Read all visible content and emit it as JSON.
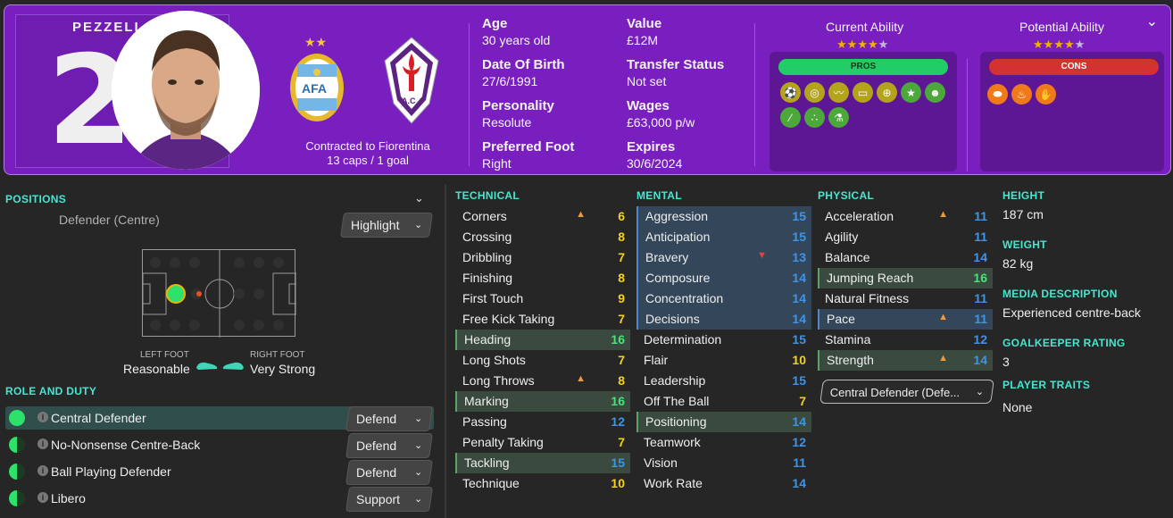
{
  "header": {
    "surname": "PEZZELLA",
    "number": "2",
    "contract": "Contracted to Fiorentina",
    "caps": "13 caps / 1 goal",
    "age": {
      "label": "Age",
      "value": "30 years old"
    },
    "dob": {
      "label": "Date Of Birth",
      "value": "27/6/1991"
    },
    "personality": {
      "label": "Personality",
      "value": "Resolute"
    },
    "foot": {
      "label": "Preferred Foot",
      "value": "Right"
    },
    "value": {
      "label": "Value",
      "value": "£12M"
    },
    "transfer": {
      "label": "Transfer Status",
      "value": "Not set"
    },
    "wages": {
      "label": "Wages",
      "value": "£63,000 p/w"
    },
    "expires": {
      "label": "Expires",
      "value": "30/6/2024"
    },
    "current_ability": {
      "label": "Current Ability",
      "stars": 3.5,
      "max": 5
    },
    "potential_ability": {
      "label": "Potential Ability",
      "stars": 3.5,
      "max": 5
    },
    "pros_label": "PROS",
    "cons_label": "CONS",
    "pros_icons": [
      "aerial-ball-icon",
      "target-icon",
      "trend-icon",
      "pitch-icon",
      "globe-icon",
      "star-icon",
      "head-icon",
      "bandage-icon",
      "cells-icon",
      "flask-icon"
    ],
    "cons_icons": [
      "pills-icon",
      "whistle-icon",
      "hand-icon"
    ],
    "colors": {
      "banner": "#7a1fbf",
      "pros": "#22cc66",
      "cons": "#d43131"
    }
  },
  "positions": {
    "title": "POSITIONS",
    "name": "Defender (Centre)",
    "highlight": "Highlight",
    "left_foot_label": "LEFT FOOT",
    "left_foot": "Reasonable",
    "right_foot_label": "RIGHT FOOT",
    "right_foot": "Very Strong"
  },
  "roles": {
    "title": "ROLE AND DUTY",
    "items": [
      {
        "name": "Central Defender",
        "duty": "Defend"
      },
      {
        "name": "No-Nonsense Centre-Back",
        "duty": "Defend"
      },
      {
        "name": "Ball Playing Defender",
        "duty": "Defend"
      },
      {
        "name": "Libero",
        "duty": "Support"
      }
    ]
  },
  "technical": {
    "title": "TECHNICAL",
    "items": [
      {
        "name": "Corners",
        "value": "6"
      },
      {
        "name": "Crossing",
        "value": "8"
      },
      {
        "name": "Dribbling",
        "value": "7"
      },
      {
        "name": "Finishing",
        "value": "8"
      },
      {
        "name": "First Touch",
        "value": "9"
      },
      {
        "name": "Free Kick Taking",
        "value": "7"
      },
      {
        "name": "Heading",
        "value": "16"
      },
      {
        "name": "Long Shots",
        "value": "7"
      },
      {
        "name": "Long Throws",
        "value": "8"
      },
      {
        "name": "Marking",
        "value": "16"
      },
      {
        "name": "Passing",
        "value": "12"
      },
      {
        "name": "Penalty Taking",
        "value": "7"
      },
      {
        "name": "Tackling",
        "value": "15"
      },
      {
        "name": "Technique",
        "value": "10"
      }
    ]
  },
  "mental": {
    "title": "MENTAL",
    "items": [
      {
        "name": "Aggression",
        "value": "15"
      },
      {
        "name": "Anticipation",
        "value": "15"
      },
      {
        "name": "Bravery",
        "value": "13"
      },
      {
        "name": "Composure",
        "value": "14"
      },
      {
        "name": "Concentration",
        "value": "14"
      },
      {
        "name": "Decisions",
        "value": "14"
      },
      {
        "name": "Determination",
        "value": "15"
      },
      {
        "name": "Flair",
        "value": "10"
      },
      {
        "name": "Leadership",
        "value": "15"
      },
      {
        "name": "Off The Ball",
        "value": "7"
      },
      {
        "name": "Positioning",
        "value": "14"
      },
      {
        "name": "Teamwork",
        "value": "12"
      },
      {
        "name": "Vision",
        "value": "11"
      },
      {
        "name": "Work Rate",
        "value": "14"
      }
    ]
  },
  "physical": {
    "title": "PHYSICAL",
    "items": [
      {
        "name": "Acceleration",
        "value": "11"
      },
      {
        "name": "Agility",
        "value": "11"
      },
      {
        "name": "Balance",
        "value": "14"
      },
      {
        "name": "Jumping Reach",
        "value": "16"
      },
      {
        "name": "Natural Fitness",
        "value": "11"
      },
      {
        "name": "Pace",
        "value": "11"
      },
      {
        "name": "Stamina",
        "value": "12"
      },
      {
        "name": "Strength",
        "value": "14"
      }
    ],
    "role_select": "Central Defender (Defe..."
  },
  "info": {
    "height_label": "HEIGHT",
    "height": "187 cm",
    "weight_label": "WEIGHT",
    "weight": "82 kg",
    "media_label": "MEDIA DESCRIPTION",
    "media": "Experienced centre-back",
    "gk_label": "GOALKEEPER RATING",
    "gk": "3",
    "traits_label": "PLAYER TRAITS",
    "traits": "None"
  }
}
